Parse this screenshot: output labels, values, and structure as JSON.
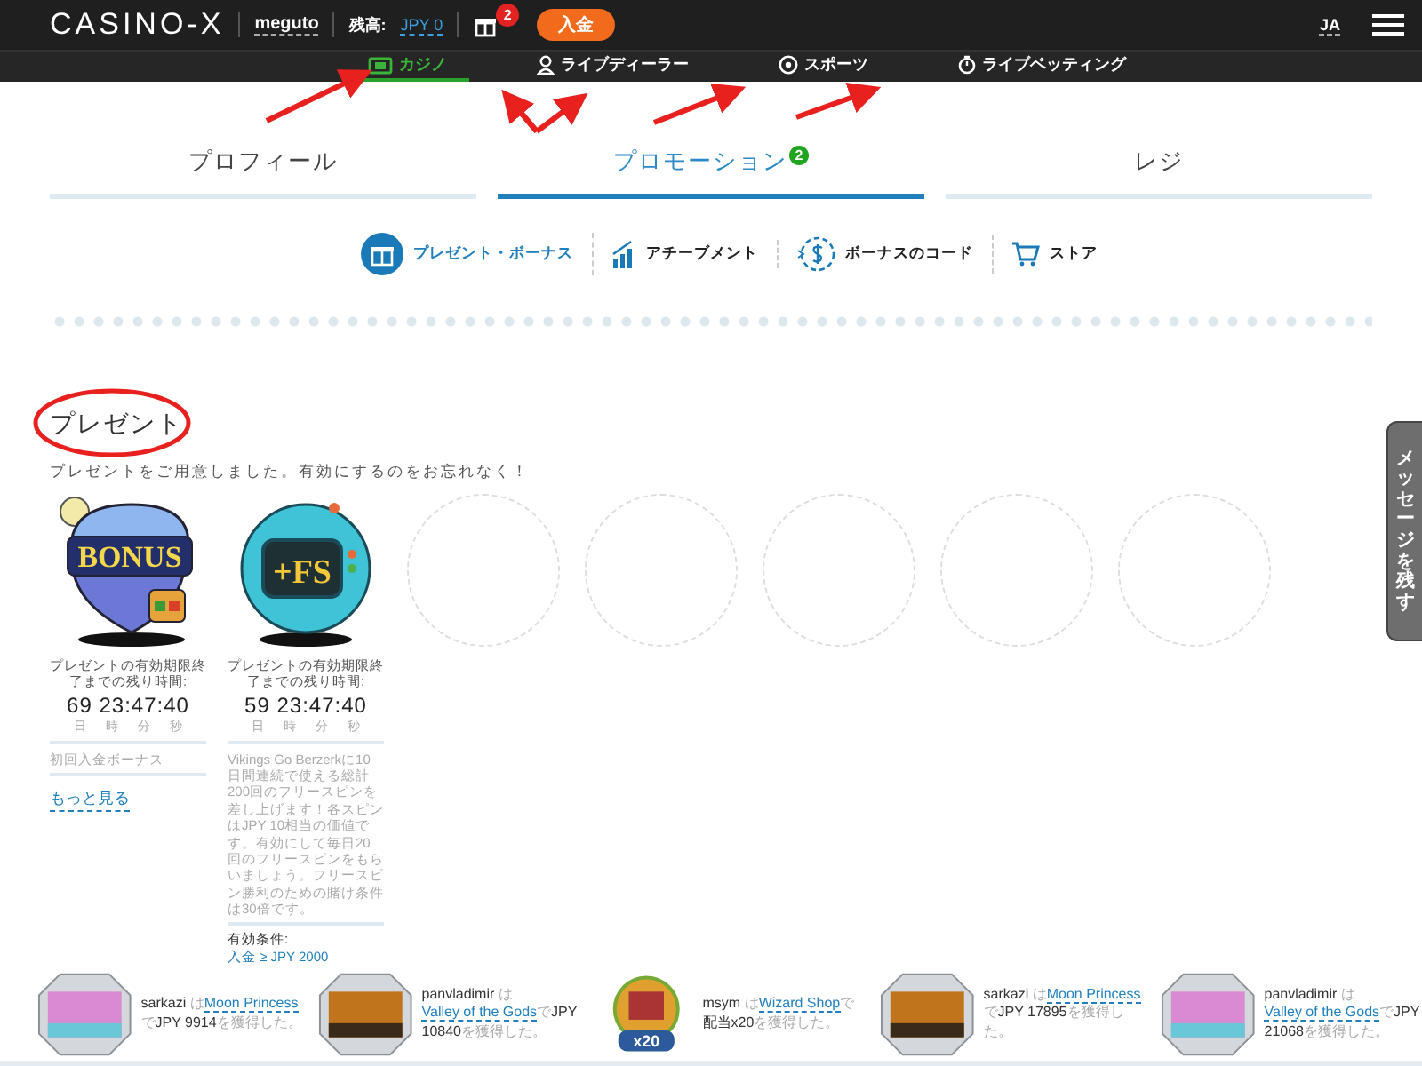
{
  "header": {
    "logo": "CASINO-X",
    "username": "meguto",
    "balance_label": "残高:",
    "balance": "JPY 0",
    "gift_count": "2",
    "deposit_button": "入金",
    "language": "JA"
  },
  "nav": [
    {
      "label": "カジノ",
      "selected": true
    },
    {
      "label": "ライブディーラー",
      "selected": false
    },
    {
      "label": "スポーツ",
      "selected": false
    },
    {
      "label": "ライブベッティング",
      "selected": false
    }
  ],
  "tabs": [
    {
      "label": "プロフィール",
      "selected": false
    },
    {
      "label": "プロモーション",
      "selected": true,
      "badge": "2"
    },
    {
      "label": "レジ",
      "selected": false
    }
  ],
  "subnav": [
    {
      "label": "プレゼント・ボーナス",
      "selected": true
    },
    {
      "label": "アチーブメント",
      "selected": false
    },
    {
      "label": "ボーナスのコード",
      "selected": false
    },
    {
      "label": "ストア",
      "selected": false
    }
  ],
  "section": {
    "title": "プレゼント",
    "subtitle": "プレゼントをご用意しました。有効にするのをお忘れなく！"
  },
  "presents": [
    {
      "kind": "bonus",
      "art_label": "BONUS",
      "timer_label": "プレゼントの有効期限終了までの残り時間:",
      "countdown": "69 23:47:40",
      "units": [
        "日",
        "時",
        "分",
        "秒"
      ],
      "description": "初回入金ボーナス",
      "link": "もっと見る"
    },
    {
      "kind": "freespins",
      "art_label": "+FS",
      "timer_label": "プレゼントの有効期限終了までの残り時間:",
      "countdown": "59 23:47:40",
      "units": [
        "日",
        "時",
        "分",
        "秒"
      ],
      "description": "Vikings Go Berzerkに10日間連続で使える総計200回のフリースピンを差し上げます！各スピンはJPY 10相当の価値です。有効にして毎日20回のフリースピンをもらいましょう。フリースピン勝利のための賭け条件は30倍です。",
      "condition_label": "有効条件:",
      "condition": "入金 ≥ JPY 2000"
    },
    {
      "kind": "empty"
    },
    {
      "kind": "empty"
    },
    {
      "kind": "empty"
    },
    {
      "kind": "empty"
    },
    {
      "kind": "empty"
    }
  ],
  "side_tab": "メッセージを残す",
  "winners": [
    {
      "user": "sarkazi",
      "pre": "は",
      "game": "Moon Princess",
      "mid": "で",
      "prize": "JPY 9914",
      "tail": "を獲得した。",
      "kind": "slot"
    },
    {
      "user": "panvladimir",
      "pre": "は",
      "game": "Valley of the Gods",
      "mid": "で",
      "prize": "JPY 10840",
      "tail": "を獲得した。",
      "kind": "slot"
    },
    {
      "user": "msym",
      "pre": "は",
      "game": "Wizard Shop",
      "mid": "で",
      "prize": "配当x20",
      "tail": "を獲得した。",
      "kind": "multiplier",
      "thumb_label": "x20"
    },
    {
      "user": "sarkazi",
      "pre": "は",
      "game": "Moon Princess",
      "mid": "で",
      "prize": "JPY 17895",
      "tail": "を獲得した。",
      "kind": "slot"
    },
    {
      "user": "panvladimir",
      "pre": "は",
      "game": "Valley of the Gods",
      "mid": "で",
      "prize": "JPY 21068",
      "tail": "を獲得した。",
      "kind": "slot"
    }
  ]
}
